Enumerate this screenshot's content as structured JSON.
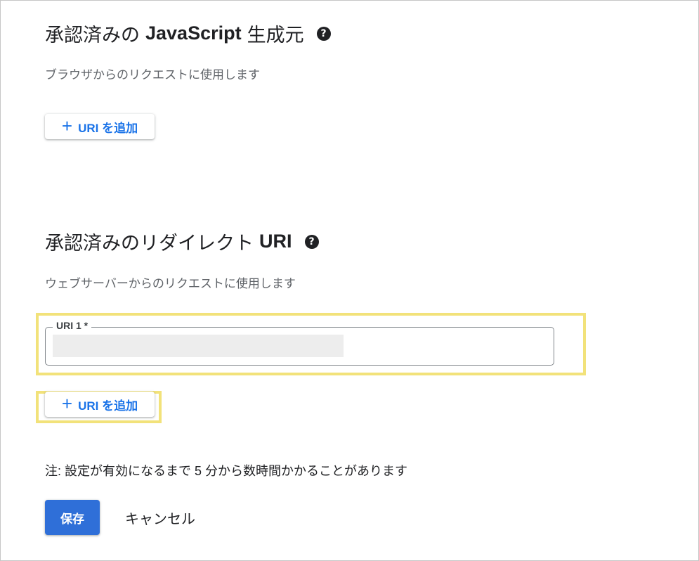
{
  "js_origins": {
    "title_prefix": "承認済みの",
    "title_strong": "JavaScript",
    "title_suffix": "生成元",
    "help_icon": "?",
    "subtitle": "ブラウザからのリクエストに使用します",
    "add_button_label": "URI を追加"
  },
  "redirect_uris": {
    "title_prefix": "承認済みのリダイレクト",
    "title_strong": "URI",
    "help_icon": "?",
    "subtitle": "ウェブサーバーからのリクエストに使用します",
    "field_label": "URI 1 *",
    "field_value": "",
    "add_button_label": "URI を追加"
  },
  "note": "注: 設定が有効になるまで 5 分から数時間かかることがあります",
  "actions": {
    "save_label": "保存",
    "cancel_label": "キャンセル"
  },
  "colors": {
    "accent": "#1a73e8",
    "primary_button": "#2f6fd8",
    "highlight": "#f2e27a"
  }
}
